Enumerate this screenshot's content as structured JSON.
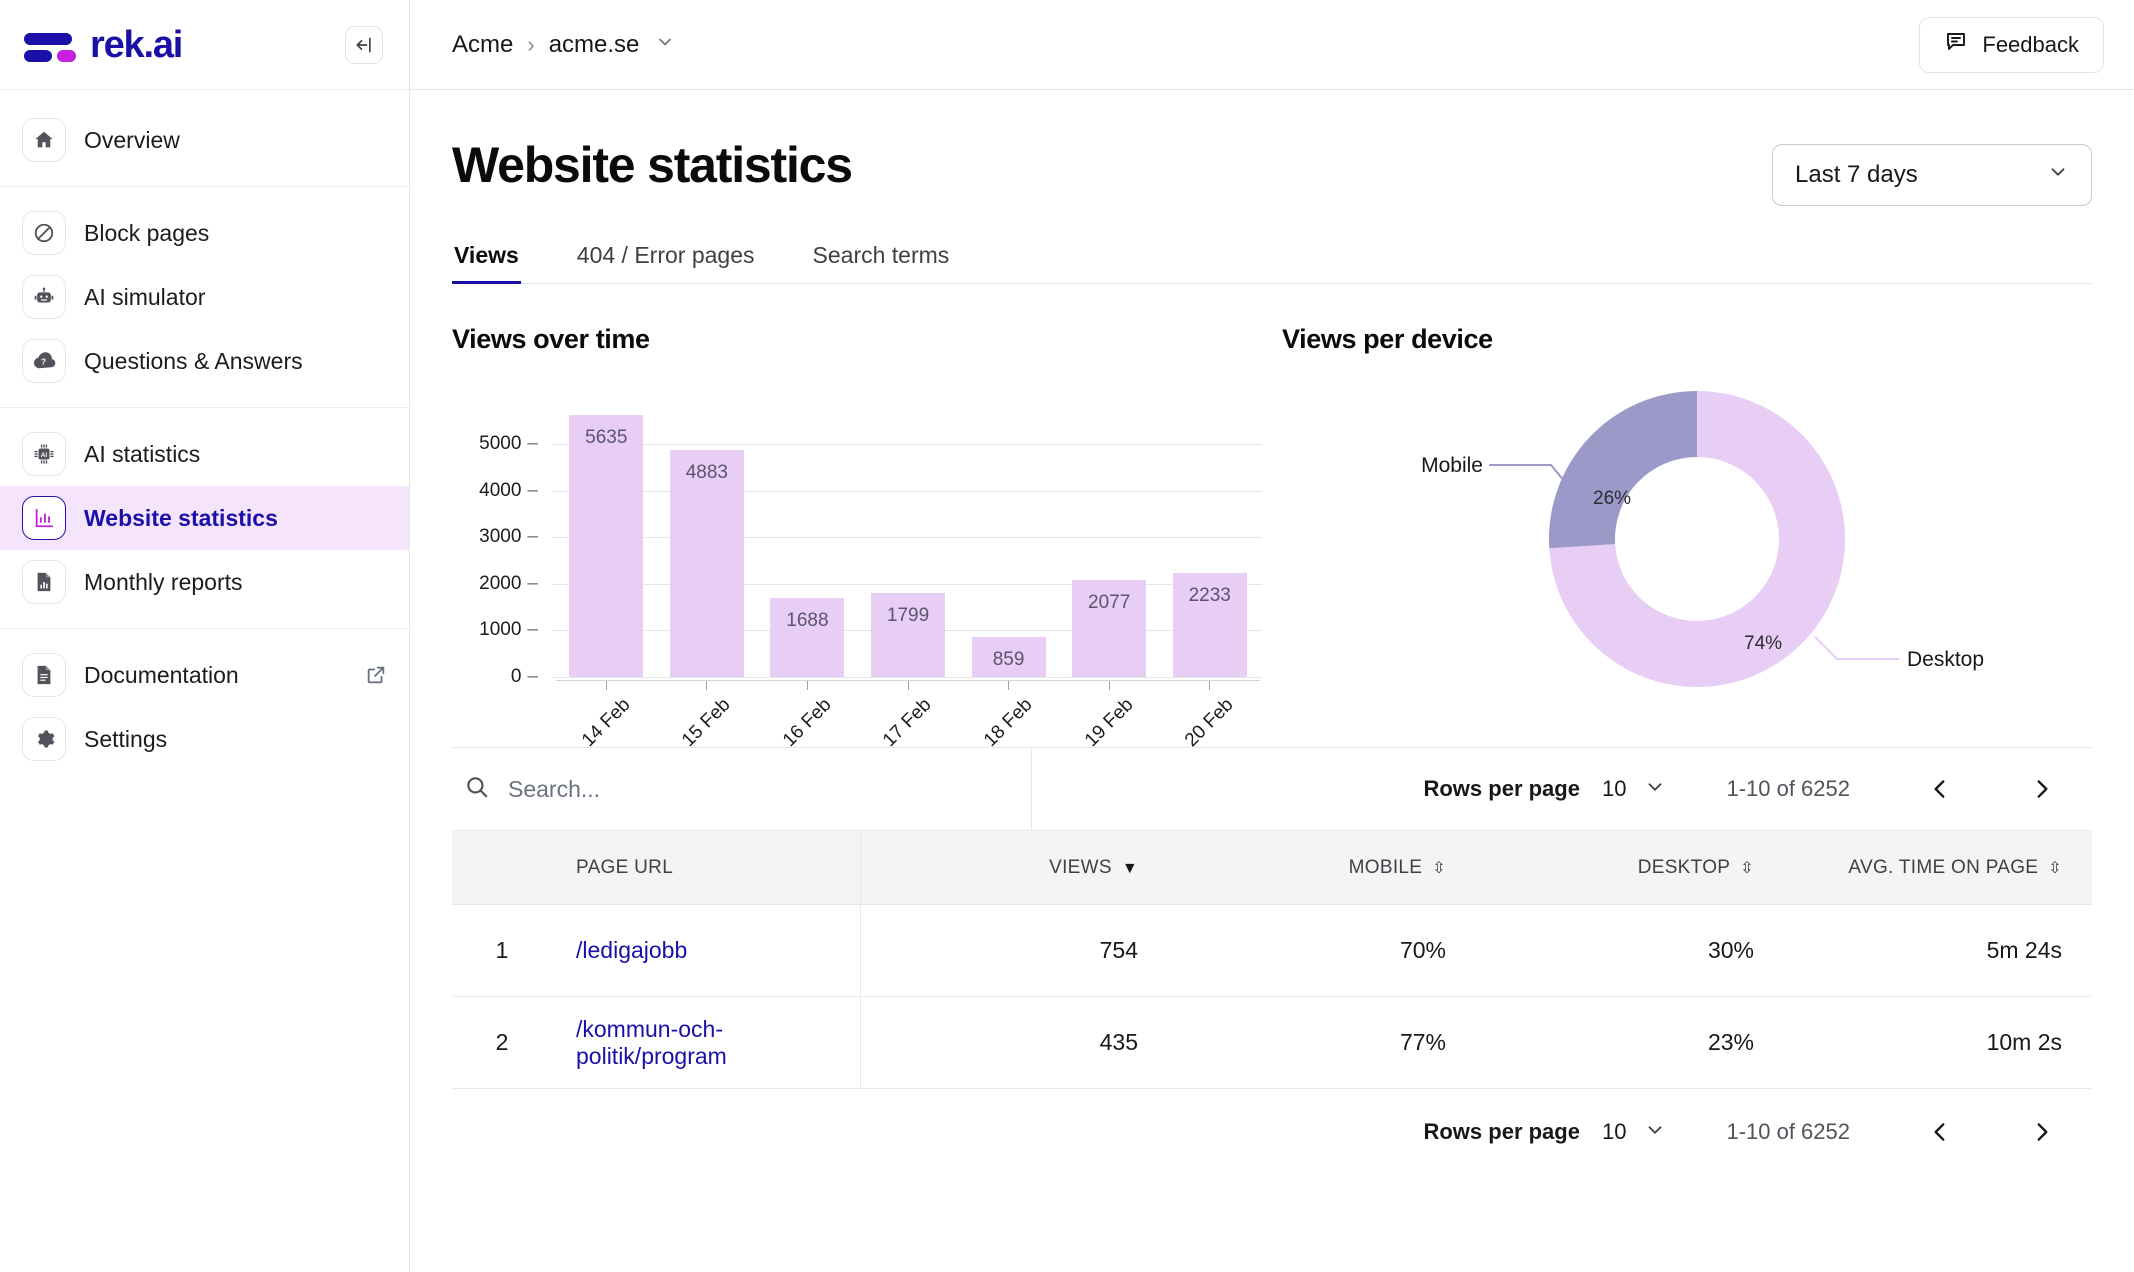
{
  "brand": {
    "name": "rek.ai"
  },
  "sidebar": {
    "collapse_icon": "collapse-panel-icon",
    "groups": [
      {
        "items": [
          {
            "label": "Overview",
            "icon": "home-icon",
            "active": false
          }
        ]
      },
      {
        "items": [
          {
            "label": "Block pages",
            "icon": "block-icon",
            "active": false
          },
          {
            "label": "AI simulator",
            "icon": "robot-icon",
            "active": false
          },
          {
            "label": "Questions & Answers",
            "icon": "cloud-question-icon",
            "active": false
          }
        ]
      },
      {
        "items": [
          {
            "label": "AI statistics",
            "icon": "chip-ai-icon",
            "active": false
          },
          {
            "label": "Website statistics",
            "icon": "bar-chart-icon",
            "active": true
          },
          {
            "label": "Monthly reports",
            "icon": "report-doc-icon",
            "active": false
          }
        ]
      },
      {
        "items": [
          {
            "label": "Documentation",
            "icon": "document-icon",
            "active": false,
            "external": true
          },
          {
            "label": "Settings",
            "icon": "gear-icon",
            "active": false
          }
        ]
      }
    ]
  },
  "topbar": {
    "breadcrumb": {
      "root": "Acme",
      "separator": "›",
      "current": "acme.se",
      "chevron": "⌄"
    },
    "feedback_label": "Feedback"
  },
  "page": {
    "title": "Website statistics",
    "date_range": {
      "value": "Last 7 days",
      "chevron": "⌄"
    },
    "tabs": [
      {
        "label": "Views",
        "active": true
      },
      {
        "label": "404 / Error pages",
        "active": false
      },
      {
        "label": "Search terms",
        "active": false
      }
    ]
  },
  "chart_data": [
    {
      "type": "bar",
      "title": "Views over time",
      "categories": [
        "14 Feb",
        "15 Feb",
        "16 Feb",
        "17 Feb",
        "18 Feb",
        "19 Feb",
        "20 Feb"
      ],
      "values": [
        5635,
        4883,
        1688,
        1799,
        859,
        2077,
        2233
      ],
      "xlabel": "",
      "ylabel": "",
      "ylim": [
        0,
        5800
      ],
      "yticks": [
        0,
        1000,
        2000,
        3000,
        4000,
        5000
      ],
      "grid": true,
      "bar_color": "#e8cdf5",
      "value_label_color": "#5b5470"
    },
    {
      "type": "pie",
      "title": "Views per device",
      "donut": true,
      "labels": [
        "Desktop",
        "Mobile"
      ],
      "values": [
        74,
        26
      ],
      "value_labels": [
        "74%",
        "26%"
      ],
      "colors": [
        "#e8cdf5",
        "#9b99c8"
      ],
      "legend": "callout-lines"
    }
  ],
  "table": {
    "search": {
      "placeholder": "Search...",
      "value": "",
      "icon": "search-icon"
    },
    "pagination": {
      "rows_per_page_label": "Rows per page",
      "rows_per_page_value": "10",
      "chevron": "⌄",
      "range_text": "1-10 of 6252",
      "prev_icon": "‹",
      "next_icon": "›"
    },
    "columns": [
      {
        "key": "idx",
        "label": ""
      },
      {
        "key": "url",
        "label": "PAGE URL",
        "sortable": false
      },
      {
        "key": "views",
        "label": "VIEWS",
        "sortable": true,
        "sort": "desc"
      },
      {
        "key": "mobile",
        "label": "MOBILE",
        "sortable": true,
        "sort": "none"
      },
      {
        "key": "desktop",
        "label": "DESKTOP",
        "sortable": true,
        "sort": "none"
      },
      {
        "key": "avg_time",
        "label": "AVG. TIME ON PAGE",
        "sortable": true,
        "sort": "none"
      }
    ],
    "rows": [
      {
        "idx": "1",
        "url": "/ledigajobb",
        "views": "754",
        "mobile": "70%",
        "desktop": "30%",
        "avg_time": "5m 24s"
      },
      {
        "idx": "2",
        "url": "/kommun-och-politik/program",
        "views": "435",
        "mobile": "77%",
        "desktop": "23%",
        "avg_time": "10m 2s"
      }
    ]
  }
}
